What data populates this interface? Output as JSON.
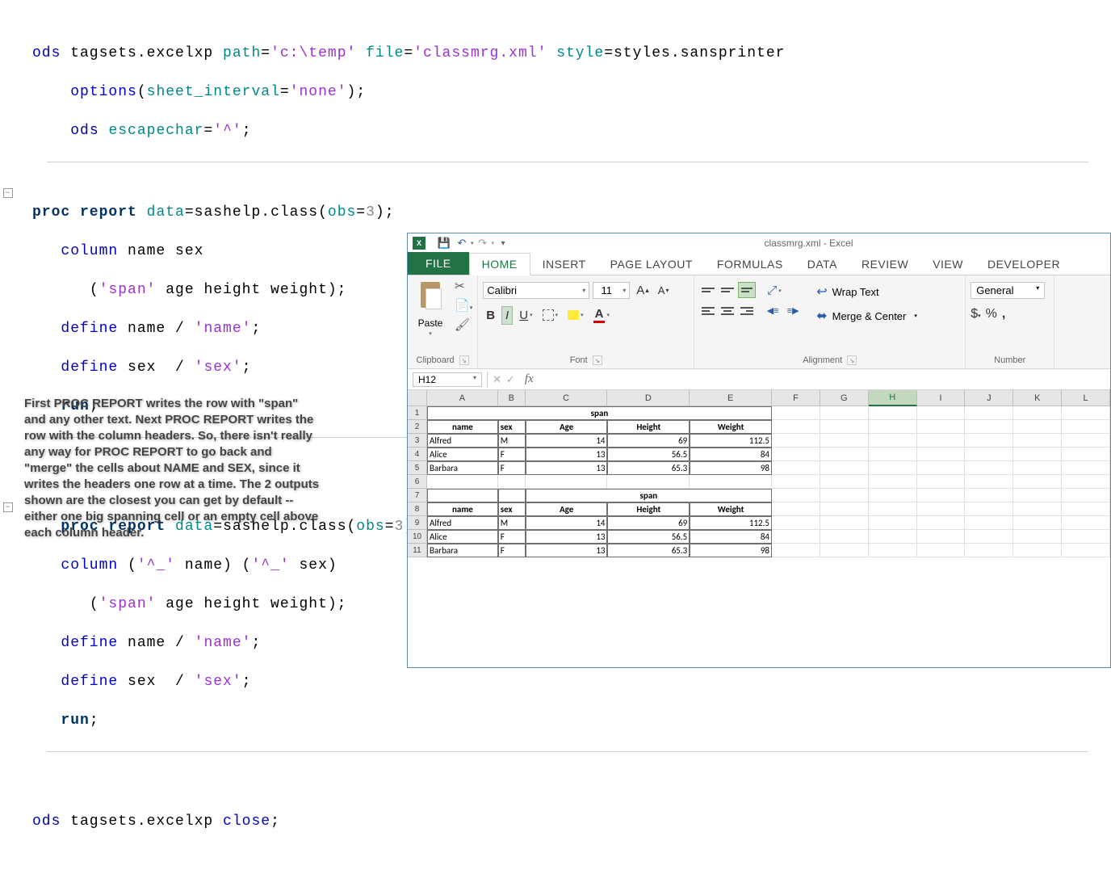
{
  "code": {
    "l1": {
      "a": "ods",
      "b": " tagsets.excelxp ",
      "c": "path",
      "d": "=",
      "e": "'c:\\temp'",
      "f": " ",
      "g": "file",
      "h": "=",
      "i": "'classmrg.xml'",
      "j": " ",
      "k": "style",
      "l": "=styles.sansprinter"
    },
    "l2": {
      "a": "options",
      "b": "(",
      "c": "sheet_interval",
      "d": "=",
      "e": "'none'",
      "f": ");"
    },
    "l3": {
      "a": "ods",
      "b": " ",
      "c": "escapechar",
      "d": "=",
      "e": "'^'",
      "f": ";"
    },
    "l4": {
      "a": "proc report",
      "b": " ",
      "c": "data",
      "d": "=sashelp.class(",
      "e": "obs",
      "f": "=",
      "g": "3",
      "h": ");"
    },
    "l5": {
      "a": "column",
      "b": " name sex"
    },
    "l6": {
      "a": "(",
      "b": "'span'",
      "c": " age height weight);"
    },
    "l7": {
      "a": "define",
      "b": " name / ",
      "c": "'name'",
      "d": ";"
    },
    "l8": {
      "a": "define",
      "b": " sex  / ",
      "c": "'sex'",
      "d": ";"
    },
    "l9": {
      "a": "run",
      "b": ";"
    },
    "l10": {
      "a": "proc report",
      "b": " ",
      "c": "data",
      "d": "=sashelp.class(",
      "e": "obs",
      "f": "=",
      "g": "3",
      "h": ");"
    },
    "l11": {
      "a": "column",
      "b": " (",
      "c": "'^_'",
      "d": " name) (",
      "e": "'^_'",
      "f": " sex)"
    },
    "l12": {
      "a": "(",
      "b": "'span'",
      "c": " age height weight);"
    },
    "l13": {
      "a": "define",
      "b": " name / ",
      "c": "'name'",
      "d": ";"
    },
    "l14": {
      "a": "define",
      "b": " sex  / ",
      "c": "'sex'",
      "d": ";"
    },
    "l15": {
      "a": "run",
      "b": ";"
    },
    "l16": {
      "a": "ods",
      "b": " tagsets.excelxp ",
      "c": "close",
      "d": ";"
    }
  },
  "annotation": "First PROC REPORT writes the row with \"span\" and any other text. Next PROC REPORT writes the row with the column headers. So, there isn't really any way for PROC REPORT to go back and \"merge\" the cells about NAME and SEX, since it writes the headers one row at a time. The 2 outputs shown are the closest you can get by default -- either one big spanning cell or an empty cell above each column header.",
  "excel": {
    "title": "classmrg.xml - Excel",
    "tabs": {
      "file": "FILE",
      "home": "HOME",
      "insert": "INSERT",
      "page": "PAGE LAYOUT",
      "formulas": "FORMULAS",
      "data": "DATA",
      "review": "REVIEW",
      "view": "VIEW",
      "developer": "DEVELOPER"
    },
    "paste": "Paste",
    "font_name": "Calibri",
    "font_size": "11",
    "wrap": "Wrap Text",
    "merge": "Merge & Center",
    "numfmt": "General",
    "grp_clip": "Clipboard",
    "grp_font": "Font",
    "grp_align": "Alignment",
    "grp_num": "Number",
    "namebox": "H12",
    "cols": {
      "A": "A",
      "B": "B",
      "C": "C",
      "D": "D",
      "E": "E",
      "F": "F",
      "G": "G",
      "H": "H",
      "I": "I",
      "J": "J",
      "K": "K",
      "L": "L"
    },
    "span": "span",
    "hdr": {
      "name": "name",
      "sex": "sex",
      "age": "Age",
      "height": "Height",
      "weight": "Weight"
    },
    "rows": {
      "r1": {
        "name": "Alfred",
        "sex": "M",
        "age": "14",
        "height": "69",
        "weight": "112.5"
      },
      "r2": {
        "name": "Alice",
        "sex": "F",
        "age": "13",
        "height": "56.5",
        "weight": "84"
      },
      "r3": {
        "name": "Barbara",
        "sex": "F",
        "age": "13",
        "height": "65.3",
        "weight": "98"
      }
    }
  }
}
